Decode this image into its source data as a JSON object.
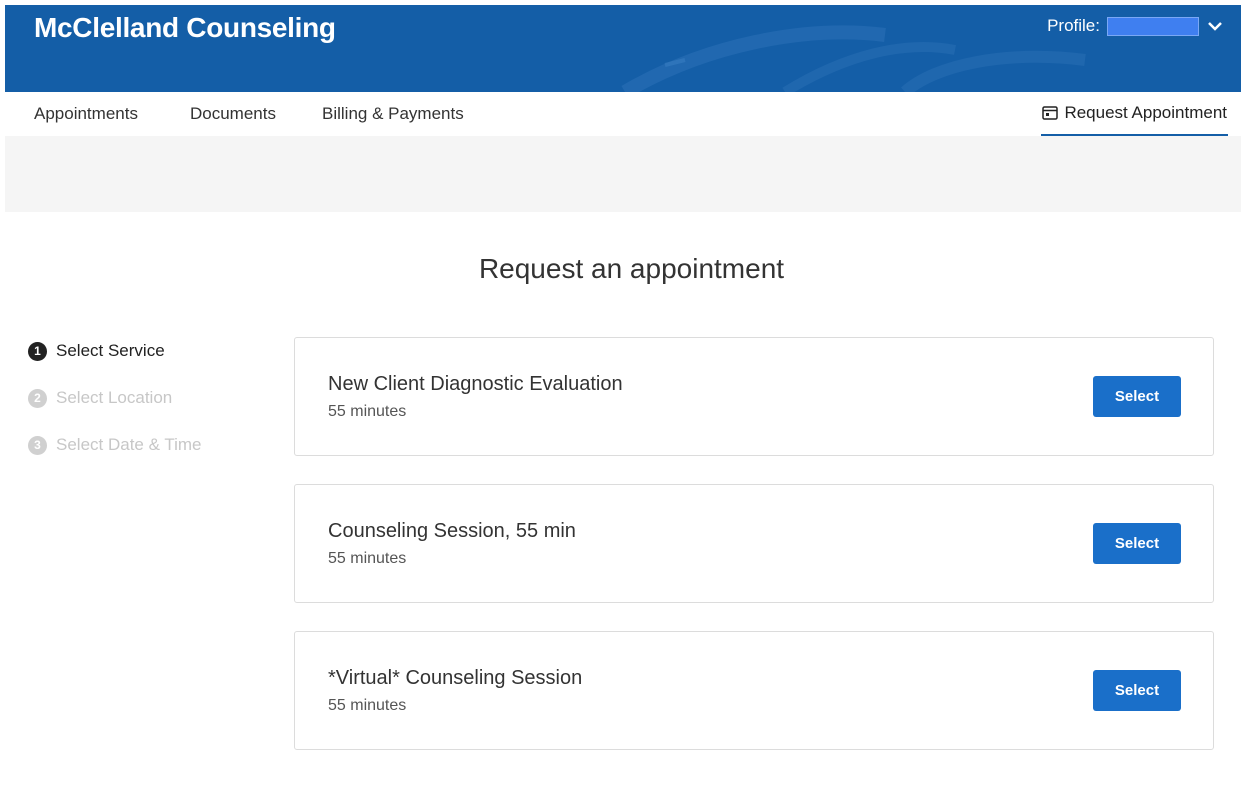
{
  "header": {
    "brand": "McClelland Counseling",
    "profile_label": "Profile:",
    "colors": {
      "primary": "#145ea7",
      "button": "#1a6fc9"
    }
  },
  "nav": {
    "items": [
      {
        "label": "Appointments"
      },
      {
        "label": "Documents"
      },
      {
        "label": "Billing & Payments"
      }
    ],
    "request_appointment": "Request Appointment"
  },
  "page": {
    "title": "Request an appointment"
  },
  "steps": [
    {
      "num": "1",
      "label": "Select Service",
      "state": "active"
    },
    {
      "num": "2",
      "label": "Select Location",
      "state": "inactive"
    },
    {
      "num": "3",
      "label": "Select Date & Time",
      "state": "inactive"
    }
  ],
  "services": [
    {
      "name": "New Client Diagnostic Evaluation",
      "duration": "55 minutes",
      "button": "Select"
    },
    {
      "name": "Counseling Session, 55 min",
      "duration": "55 minutes",
      "button": "Select"
    },
    {
      "name": "*Virtual* Counseling Session",
      "duration": "55 minutes",
      "button": "Select"
    }
  ]
}
